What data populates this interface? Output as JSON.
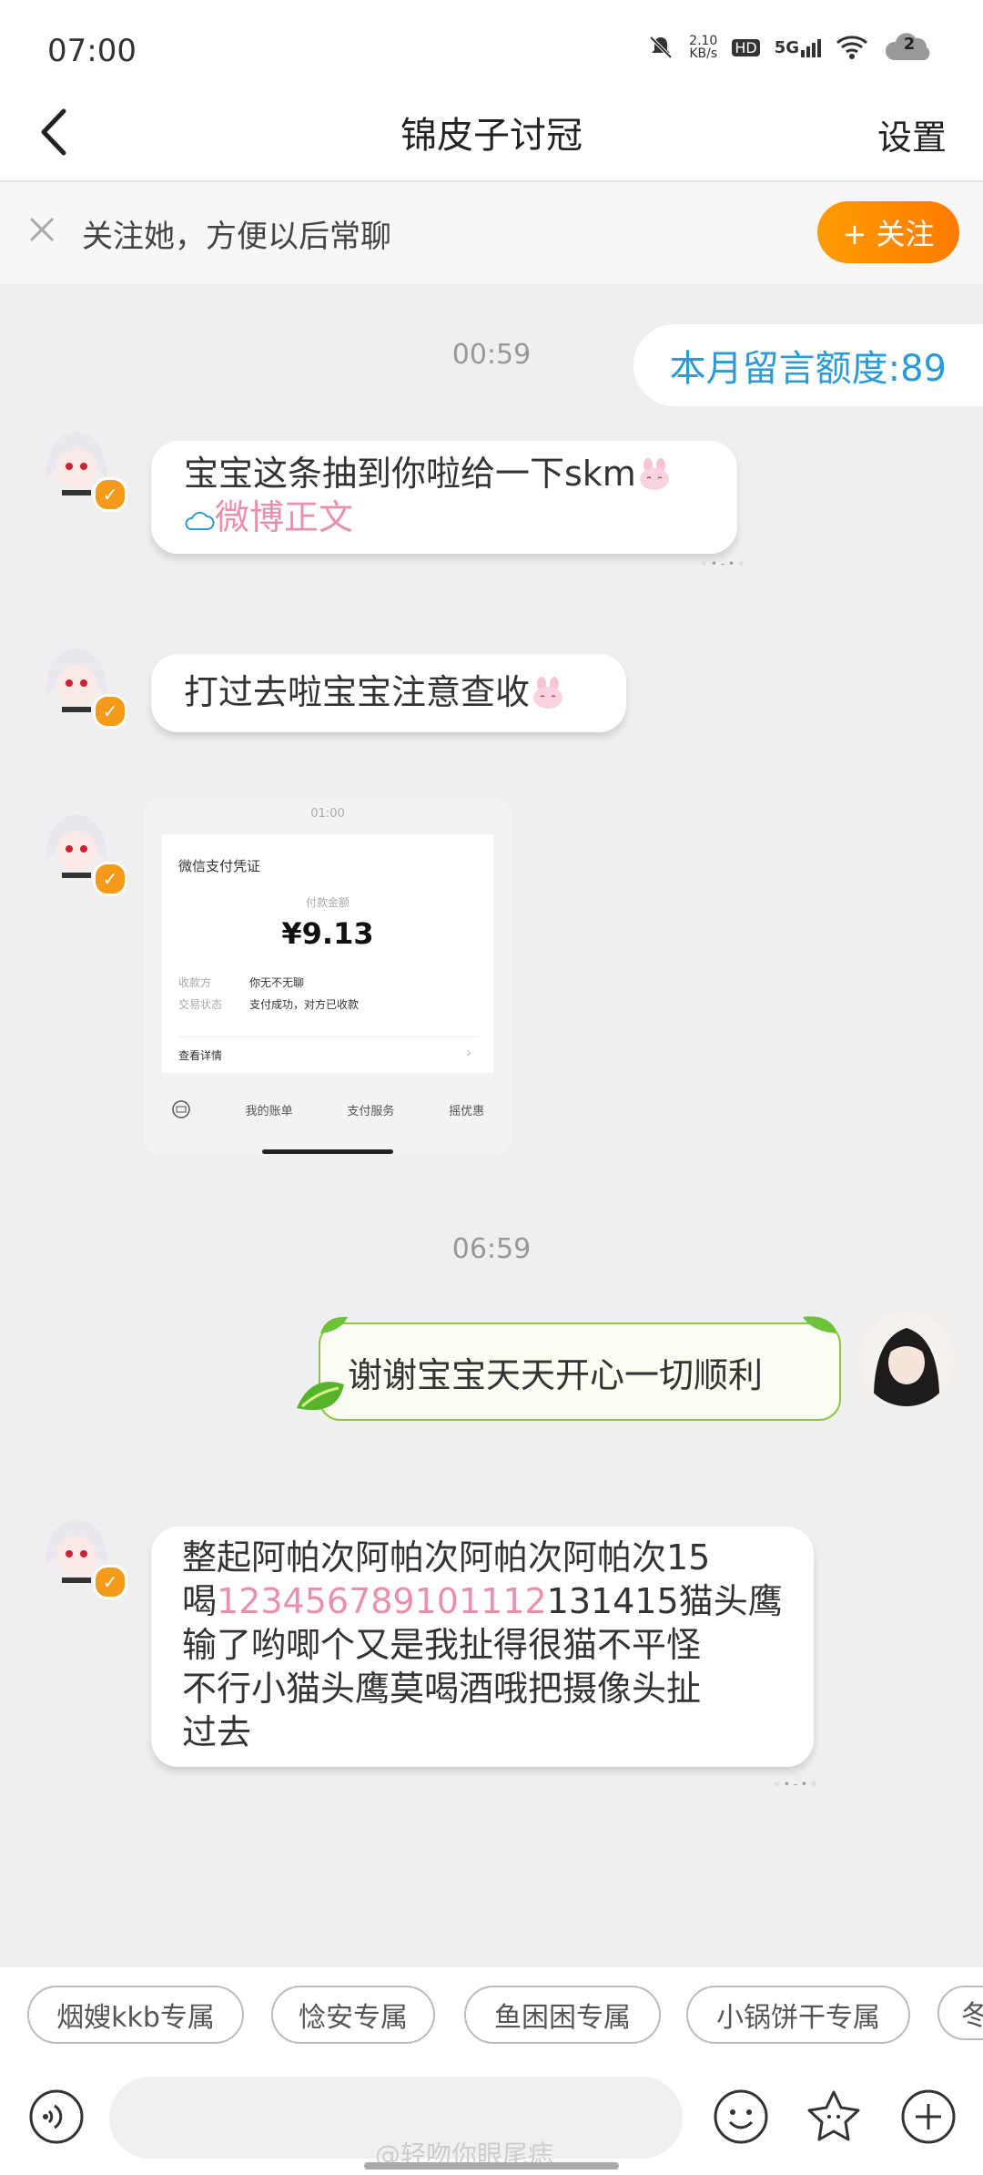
{
  "status_bar": {
    "time": "07:00",
    "net_speed": "2.10\nKB/s",
    "hd": "HD",
    "network": "5G",
    "cloud_count": "2"
  },
  "nav": {
    "title": "锦皮子讨冠",
    "settings": "设置"
  },
  "follow_bar": {
    "text": "关注她，方便以后常聊",
    "button": "+ 关注"
  },
  "chat": {
    "quota": "本月留言额度:89",
    "time1": "00:59",
    "msg1_text": "宝宝这条抽到你啦给一下skm",
    "msg1_link": "微博正文",
    "msg2_text": "打过去啦宝宝注意查收",
    "payment": {
      "top_time": "01:00",
      "title": "微信支付凭证",
      "amount_label": "付款金额",
      "amount": "¥9.13",
      "payee_label": "收款方",
      "payee": "你无不无聊",
      "status_label": "交易状态",
      "status": "支付成功，对方已收款",
      "details": "查看详情",
      "nav": [
        "我的账单",
        "支付服务",
        "摇优惠"
      ]
    },
    "time2": "06:59",
    "msg3_text": "谢谢宝宝天天开心一切顺利",
    "msg4_line1": "整起阿帕次阿帕次阿帕次阿帕次15",
    "msg4_line2_a": "喝",
    "msg4_line2_pink": "123456789101112",
    "msg4_line2_b": "131415猫头鹰",
    "msg4_line3": "输了哟唧个又是我扯得很猫不平怪",
    "msg4_line4": "不行小猫头鹰莫喝酒哦把摄像头扯",
    "msg4_line5": "过去"
  },
  "chips": [
    "烟嫂kkb专属",
    "惗安专属",
    "鱼困困专属",
    "小锅饼干专属",
    "冬"
  ],
  "watermark": "@轻吻你眼尾痣",
  "colors": {
    "accent_orange": "#ff8a00",
    "link_blue": "#2a9bd8",
    "link_pink": "#e98fb2"
  }
}
